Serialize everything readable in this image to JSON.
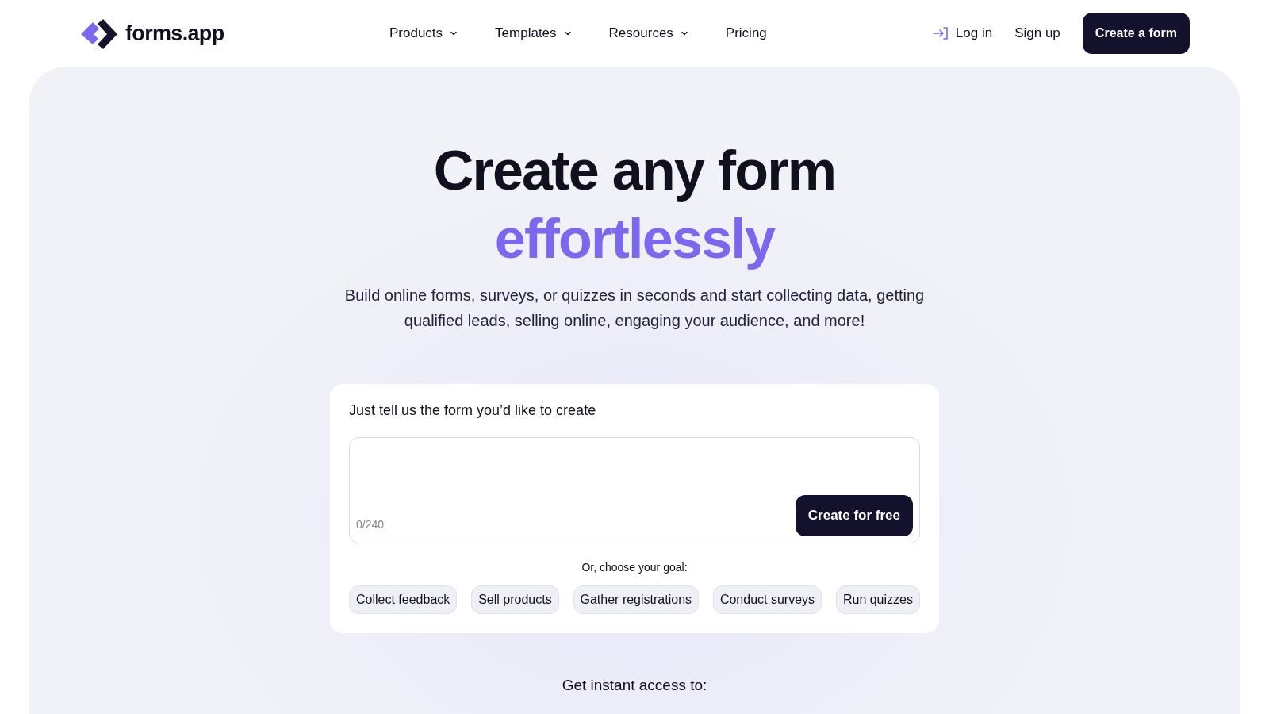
{
  "header": {
    "logo": "forms.app",
    "nav": [
      {
        "label": "Products",
        "kind": "dropdown"
      },
      {
        "label": "Templates",
        "kind": "dropdown"
      },
      {
        "label": "Resources",
        "kind": "dropdown"
      },
      {
        "label": "Pricing",
        "kind": "link"
      }
    ],
    "login": "Log in",
    "signup": "Sign up",
    "cta": "Create a form"
  },
  "hero": {
    "title": "Create any form",
    "title_accent": "effortlessly",
    "subtitle": "Build online forms, surveys, or quizzes in seconds and start collecting data, getting qualified leads, selling online, engaging your audience, and more!"
  },
  "prompt_card": {
    "label": "Just tell us the form you’d like to create",
    "counter": "0/240",
    "button": "Create for free",
    "goal_label": "Or, choose your goal:",
    "goals": [
      "Collect feedback",
      "Sell products",
      "Gather registrations",
      "Conduct surveys",
      "Run quizzes"
    ]
  },
  "footer_heading": "Get instant access to:"
}
